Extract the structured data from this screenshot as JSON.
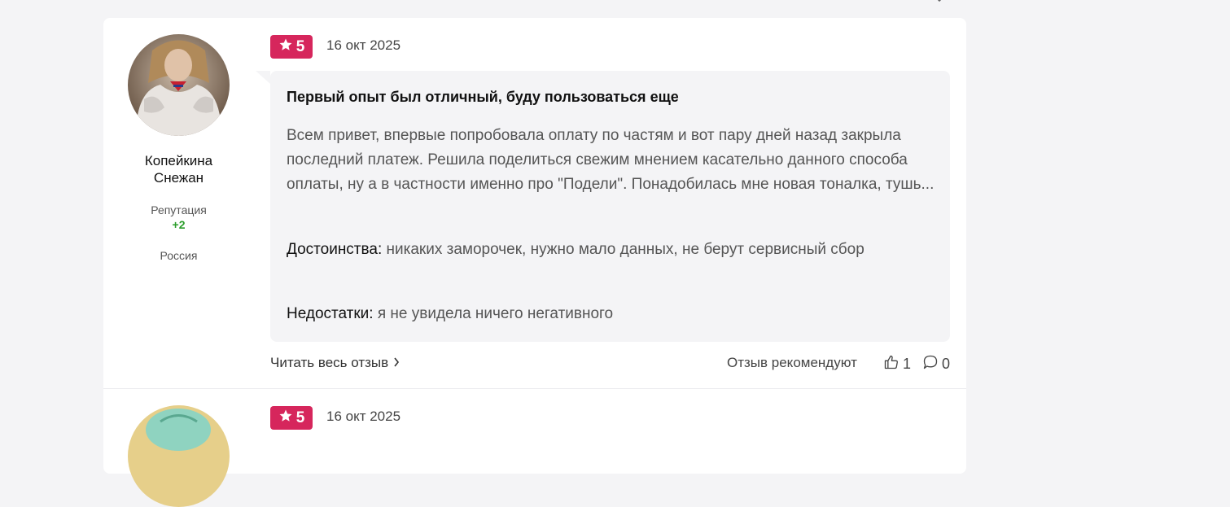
{
  "reviews": [
    {
      "author": "Копейкина Снежан",
      "reputation_label": "Репутация",
      "reputation_value": "+2",
      "country": "Россия",
      "rating": "5",
      "date": "16 окт 2025",
      "title": "Первый опыт был отличный, буду пользоваться еще",
      "text": "Всем привет, впервые попробовала оплату по частям и вот пару дней назад закрыла последний платеж. Решила поделиться свежим мнением касательно данного способа оплаты, ну а в частности именно про \"Подели\". Понадобилась мне новая тоналка, тушь...",
      "pros_label": "Достоинства:",
      "pros": "никаких заморочек, нужно мало данных, не берут сервисный сбор",
      "cons_label": "Недостатки:",
      "cons": "я не увидела ничего негативного",
      "read_more": "Читать весь отзыв",
      "recommend_label": "Отзыв рекомендуют",
      "likes": "1",
      "comments": "0"
    },
    {
      "rating": "5",
      "date": "16 окт 2025"
    }
  ],
  "colors": {
    "badge": "#d6265c",
    "reputation": "#2a9d2a",
    "page_bg": "#f4f4f6"
  },
  "icons": [
    "star-icon",
    "chevron-right-icon",
    "thumbs-up-icon",
    "comment-icon"
  ]
}
